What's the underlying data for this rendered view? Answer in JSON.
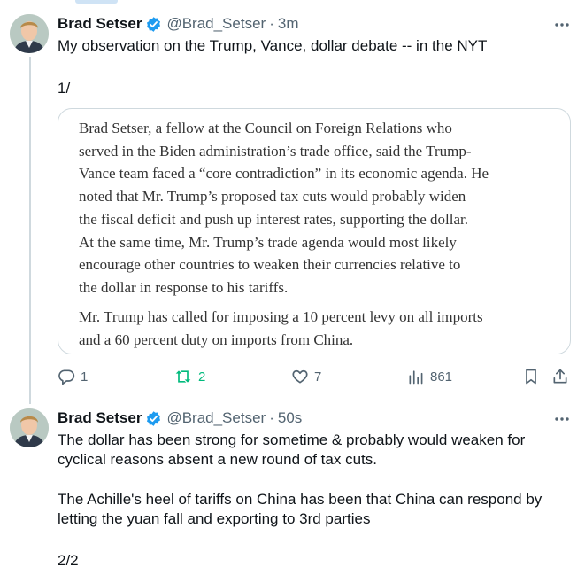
{
  "tweets": [
    {
      "name": "Brad Setser",
      "handle": "@Brad_Setser",
      "separator": "·",
      "time": "3m",
      "lines": [
        "My observation on the Trump, Vance, dollar debate -- in the NYT",
        "",
        "1/"
      ],
      "quote": {
        "paragraph1": [
          "Brad Setser, a fellow at the Council on Foreign Relations who",
          "served in the Biden administration’s trade office, said the Trump-",
          "Vance team faced a “core contradiction” in its economic agenda. He",
          "noted that Mr. Trump’s proposed tax cuts would probably widen",
          "the fiscal deficit and push up interest rates, supporting the dollar.",
          "At the same time, Mr. Trump’s trade agenda would most likely",
          "encourage other countries to weaken their currencies relative to",
          "the dollar in response to his tariffs."
        ],
        "paragraph2": [
          "Mr. Trump has called for imposing a 10 percent levy on all imports",
          "and a 60 percent duty on imports from China."
        ]
      },
      "actions": {
        "replies": "1",
        "reposts": "2",
        "likes": "7",
        "views": "861"
      }
    },
    {
      "name": "Brad Setser",
      "handle": "@Brad_Setser",
      "separator": "·",
      "time": "50s",
      "lines": [
        "The dollar has been strong for sometime & probably would weaken for",
        "cyclical reasons absent a new round of tax cuts.",
        "",
        "The Achille's heel of tariffs on China has been that China can respond by",
        "letting the yuan fall and exporting to 3rd parties",
        "",
        "2/2"
      ]
    }
  ],
  "icons": {
    "verified": "verified-badge-icon",
    "more": "more-horizontal-icon",
    "reply": "reply-icon",
    "repost": "repost-icon",
    "like": "heart-icon",
    "views": "views-bar-chart-icon",
    "bookmark": "bookmark-icon",
    "share": "share-icon"
  },
  "colors": {
    "verified": "#1d9bf0",
    "repost": "#00ba7c",
    "secondary_text": "#536471",
    "border": "#cfd9de"
  }
}
